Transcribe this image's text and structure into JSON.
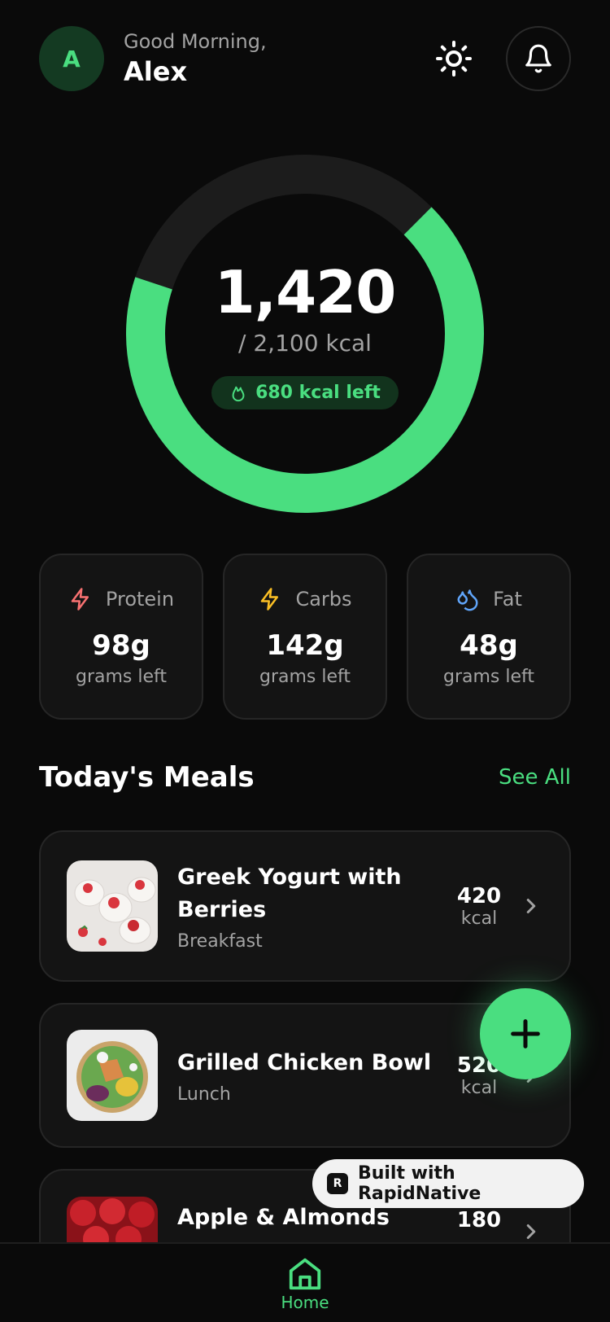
{
  "header": {
    "avatar_initial": "A",
    "greeting": "Good Morning,",
    "user_name": "Alex"
  },
  "calories": {
    "consumed": "1,420",
    "goal": "/ 2,100 kcal",
    "left_label": "680 kcal left",
    "progress_fraction": 0.676
  },
  "macros": [
    {
      "name": "Protein",
      "value": "98g",
      "sub": "grams left",
      "color": "#f87171",
      "icon": "bolt-icon"
    },
    {
      "name": "Carbs",
      "value": "142g",
      "sub": "grams left",
      "color": "#fbbf24",
      "icon": "bolt-icon"
    },
    {
      "name": "Fat",
      "value": "48g",
      "sub": "grams left",
      "color": "#60a5fa",
      "icon": "drops-icon"
    }
  ],
  "meals_section": {
    "title": "Today's Meals",
    "see_all": "See All"
  },
  "meals": [
    {
      "name_line1": "Greek Yogurt with",
      "name_line2": "Berries",
      "type": "Breakfast",
      "kcal": "420",
      "unit": "kcal"
    },
    {
      "name_line1": "Grilled Chicken Bowl",
      "type": "Lunch",
      "kcal": "520",
      "unit": "kcal"
    },
    {
      "name_line1": "Apple & Almonds",
      "kcal": "180"
    }
  ],
  "badge": {
    "label": "Built with RapidNative"
  },
  "tabbar": {
    "home_label": "Home"
  },
  "colors": {
    "accent": "#4ade80",
    "background": "#0a0a0a",
    "card": "#141414"
  }
}
